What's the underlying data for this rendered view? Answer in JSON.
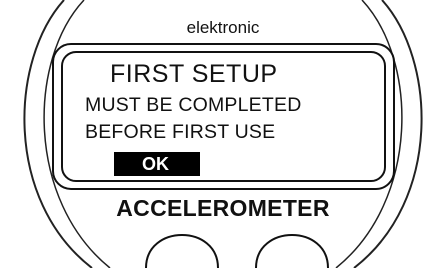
{
  "device": {
    "brand": "elektronic",
    "model": "ACCELEROMETER"
  },
  "screen": {
    "title": "FIRST SETUP",
    "lines": [
      "MUST BE COMPLETED",
      "BEFORE FIRST USE"
    ],
    "ok_label": "OK"
  }
}
